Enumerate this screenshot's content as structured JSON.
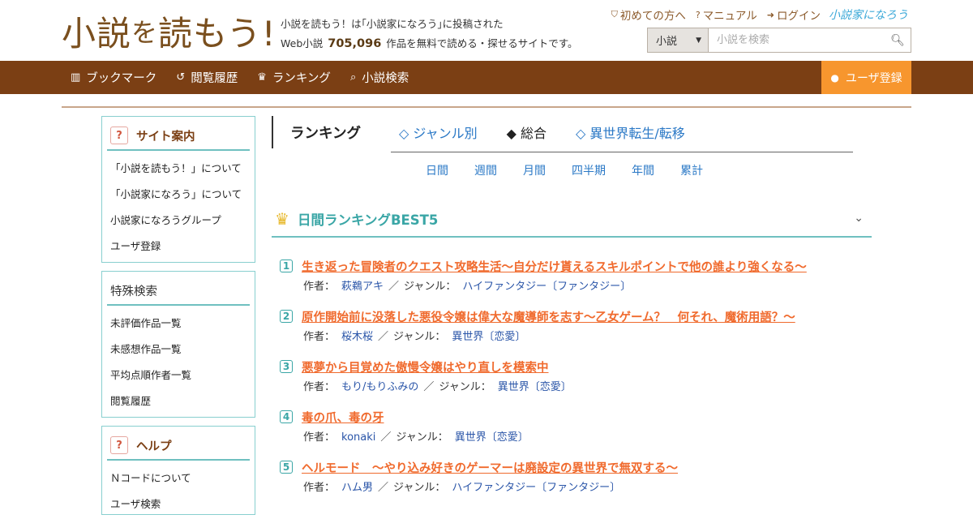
{
  "header": {
    "logo_a": "小説",
    "logo_b": "を",
    "logo_c": "読もう!",
    "tagline_line1": "小説を読もう！は｢小説家になろう｣に投稿された",
    "tagline_prefix": "Web小説",
    "work_count": "705,096",
    "tagline_suffix": "作品を無料で読める・探せるサイトです。",
    "links": [
      "初めての方へ",
      "マニュアル",
      "ログイン"
    ],
    "brand": "小説家になろう",
    "search": {
      "category": "小説",
      "placeholder": "小説を検索"
    }
  },
  "nav": {
    "items": [
      "ブックマーク",
      "閲覧履歴",
      "ランキング",
      "小説検索"
    ],
    "register": "ユーザ登録"
  },
  "sidebar": {
    "site_guide": {
      "title": "サイト案内",
      "items": [
        "「小説を読もう！」について",
        "「小説家になろう」について",
        "小説家になろうグループ",
        "ユーザ登録"
      ]
    },
    "special_search": {
      "title": "特殊検索",
      "items": [
        "未評価作品一覧",
        "未感想作品一覧",
        "平均点順作者一覧",
        "閲覧履歴"
      ]
    },
    "help": {
      "title": "ヘルプ",
      "items": [
        "Ｎコードについて",
        "ユーザ検索"
      ]
    }
  },
  "ranking": {
    "title": "ランキング",
    "tabs": [
      "◇ ジャンル別",
      "◆ 総合",
      "◇ 異世界転生/転移"
    ],
    "periods": [
      "日間",
      "週間",
      "月間",
      "四半期",
      "年間",
      "累計"
    ],
    "best_title": "日間ランキングBEST5",
    "author_label": "作者：",
    "genre_label": "ジャンル：",
    "slash": "／",
    "entries": [
      {
        "rank": "1",
        "title": "生き返った冒険者のクエスト攻略生活～自分だけ貰えるスキルポイントで他の誰より強くなる～",
        "author": "萩鵜アキ",
        "genre": "ハイファンタジー〔ファンタジー〕"
      },
      {
        "rank": "2",
        "title": "原作開始前に没落した悪役令嬢は偉大な魔導師を志す～乙女ゲーム？　何それ、魔術用語？～",
        "author": "桜木桜",
        "genre": "異世界〔恋愛〕"
      },
      {
        "rank": "3",
        "title": "悪夢から目覚めた傲慢令嬢はやり直しを模索中",
        "author": "もり/もりふみの",
        "genre": "異世界〔恋愛〕"
      },
      {
        "rank": "4",
        "title": "毒の爪、毒の牙",
        "author": "konaki",
        "genre": "異世界〔恋愛〕"
      },
      {
        "rank": "5",
        "title": "ヘルモード　～やり込み好きのゲーマーは廃設定の異世界で無双する～",
        "author": "ハム男",
        "genre": "ハイファンタジー〔ファンタジー〕"
      }
    ]
  },
  "colors": {
    "nav_bg": "#7b3f14",
    "accent_orange": "#f7962e",
    "title_orange": "#f06a2d",
    "teal": "#3aa6a6",
    "link_blue": "#2a78c6"
  }
}
